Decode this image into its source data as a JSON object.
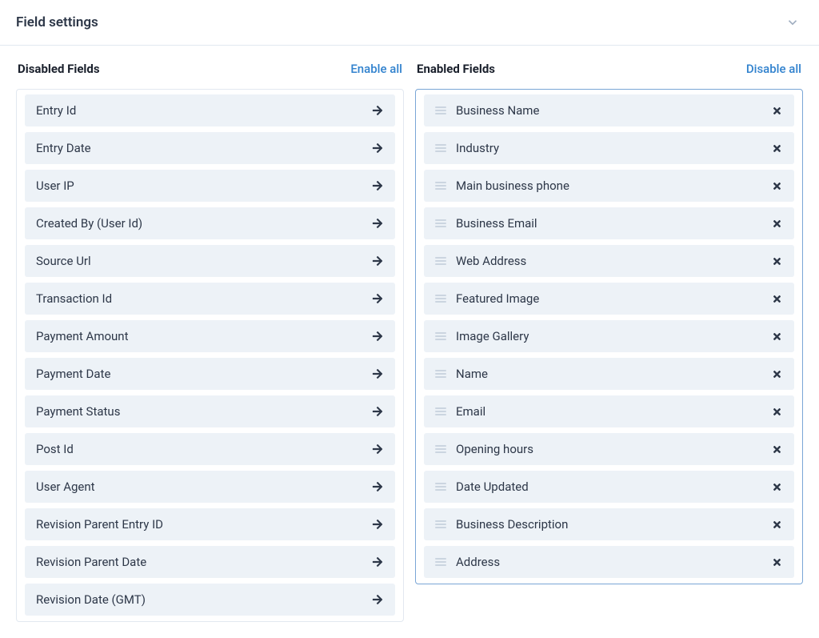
{
  "header": {
    "title": "Field settings"
  },
  "disabled": {
    "title": "Disabled Fields",
    "action": "Enable all",
    "items": [
      "Entry Id",
      "Entry Date",
      "User IP",
      "Created By (User Id)",
      "Source Url",
      "Transaction Id",
      "Payment Amount",
      "Payment Date",
      "Payment Status",
      "Post Id",
      "User Agent",
      "Revision Parent Entry ID",
      "Revision Parent Date",
      "Revision Date (GMT)"
    ]
  },
  "enabled": {
    "title": "Enabled Fields",
    "action": "Disable all",
    "items": [
      "Business Name",
      "Industry",
      "Main business phone",
      "Business Email",
      "Web Address",
      "Featured Image",
      "Image Gallery",
      "Name",
      "Email",
      "Opening hours",
      "Date Updated",
      "Business Description",
      "Address"
    ]
  }
}
